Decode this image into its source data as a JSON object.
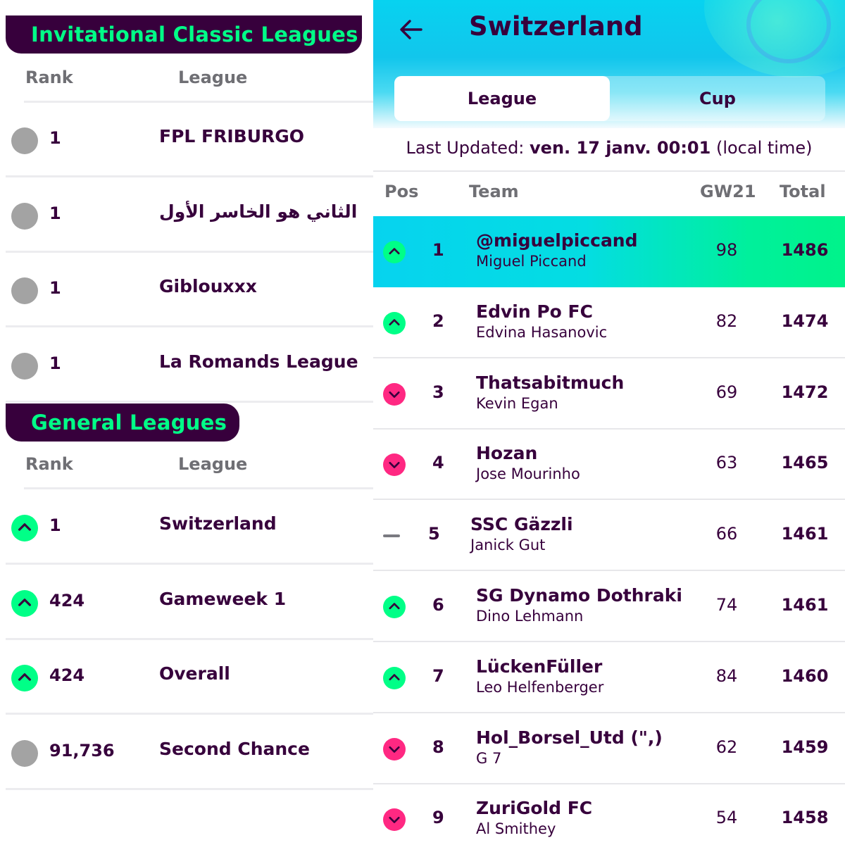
{
  "left": {
    "invitational": {
      "title": "Invitational Classic Leagues",
      "col_rank": "Rank",
      "col_league": "League",
      "rows": [
        {
          "rank": "1",
          "name": "FPL FRIBURGO",
          "movement": "same"
        },
        {
          "rank": "1",
          "name": "الثاني هو الخاسر الأول",
          "movement": "same"
        },
        {
          "rank": "1",
          "name": "Giblouxxx",
          "movement": "same"
        },
        {
          "rank": "1",
          "name": "La Romands League",
          "movement": "same"
        }
      ]
    },
    "general": {
      "title": "General Leagues",
      "col_rank": "Rank",
      "col_league": "League",
      "rows": [
        {
          "rank": "1",
          "name": "Switzerland",
          "movement": "up"
        },
        {
          "rank": "424",
          "name": "Gameweek 1",
          "movement": "up"
        },
        {
          "rank": "424",
          "name": "Overall",
          "movement": "up"
        },
        {
          "rank": "91,736",
          "name": "Second Chance",
          "movement": "same"
        }
      ]
    }
  },
  "right": {
    "title": "Switzerland",
    "back_icon": "arrow-left-icon",
    "tabs": {
      "league": "League",
      "cup": "Cup",
      "active": "League"
    },
    "last_updated_label": "Last Updated:",
    "last_updated_value": "ven. 17 janv. 00:01",
    "last_updated_suffix": "(local time)",
    "columns": {
      "pos": "Pos",
      "team": "Team",
      "gw": "GW21",
      "total": "Total"
    },
    "standings": [
      {
        "pos": "1",
        "team": "@miguelpiccand",
        "manager": "Miguel Piccand",
        "gw": "98",
        "total": "1486",
        "movement": "up",
        "highlight": true
      },
      {
        "pos": "2",
        "team": "Edvin Po FC",
        "manager": "Edvina Hasanovic",
        "gw": "82",
        "total": "1474",
        "movement": "up"
      },
      {
        "pos": "3",
        "team": "Thatsabitmuch",
        "manager": "Kevin Egan",
        "gw": "69",
        "total": "1472",
        "movement": "down"
      },
      {
        "pos": "4",
        "team": "Hozan",
        "manager": "Jose Mourinho",
        "gw": "63",
        "total": "1465",
        "movement": "down"
      },
      {
        "pos": "5",
        "team": "SSC Gäzzli",
        "manager": "Janick Gut",
        "gw": "66",
        "total": "1461",
        "movement": "same"
      },
      {
        "pos": "6",
        "team": "SG Dynamo Dothraki",
        "manager": "Dino Lehmann",
        "gw": "74",
        "total": "1461",
        "movement": "up"
      },
      {
        "pos": "7",
        "team": "LückenFüller",
        "manager": "Leo Helfenberger",
        "gw": "84",
        "total": "1460",
        "movement": "up"
      },
      {
        "pos": "8",
        "team": "Hol_Borsel_Utd (\",)",
        "manager": "G 7",
        "gw": "62",
        "total": "1459",
        "movement": "down"
      },
      {
        "pos": "9",
        "team": "ZuriGold FC",
        "manager": "Al Smithey",
        "gw": "54",
        "total": "1458",
        "movement": "down"
      }
    ]
  },
  "colors": {
    "primary": "#37003c",
    "accent_green": "#00ff87",
    "down_pink": "#ff2882",
    "same_grey": "#a3a3a3",
    "header_cyan": "#07d2f0"
  }
}
